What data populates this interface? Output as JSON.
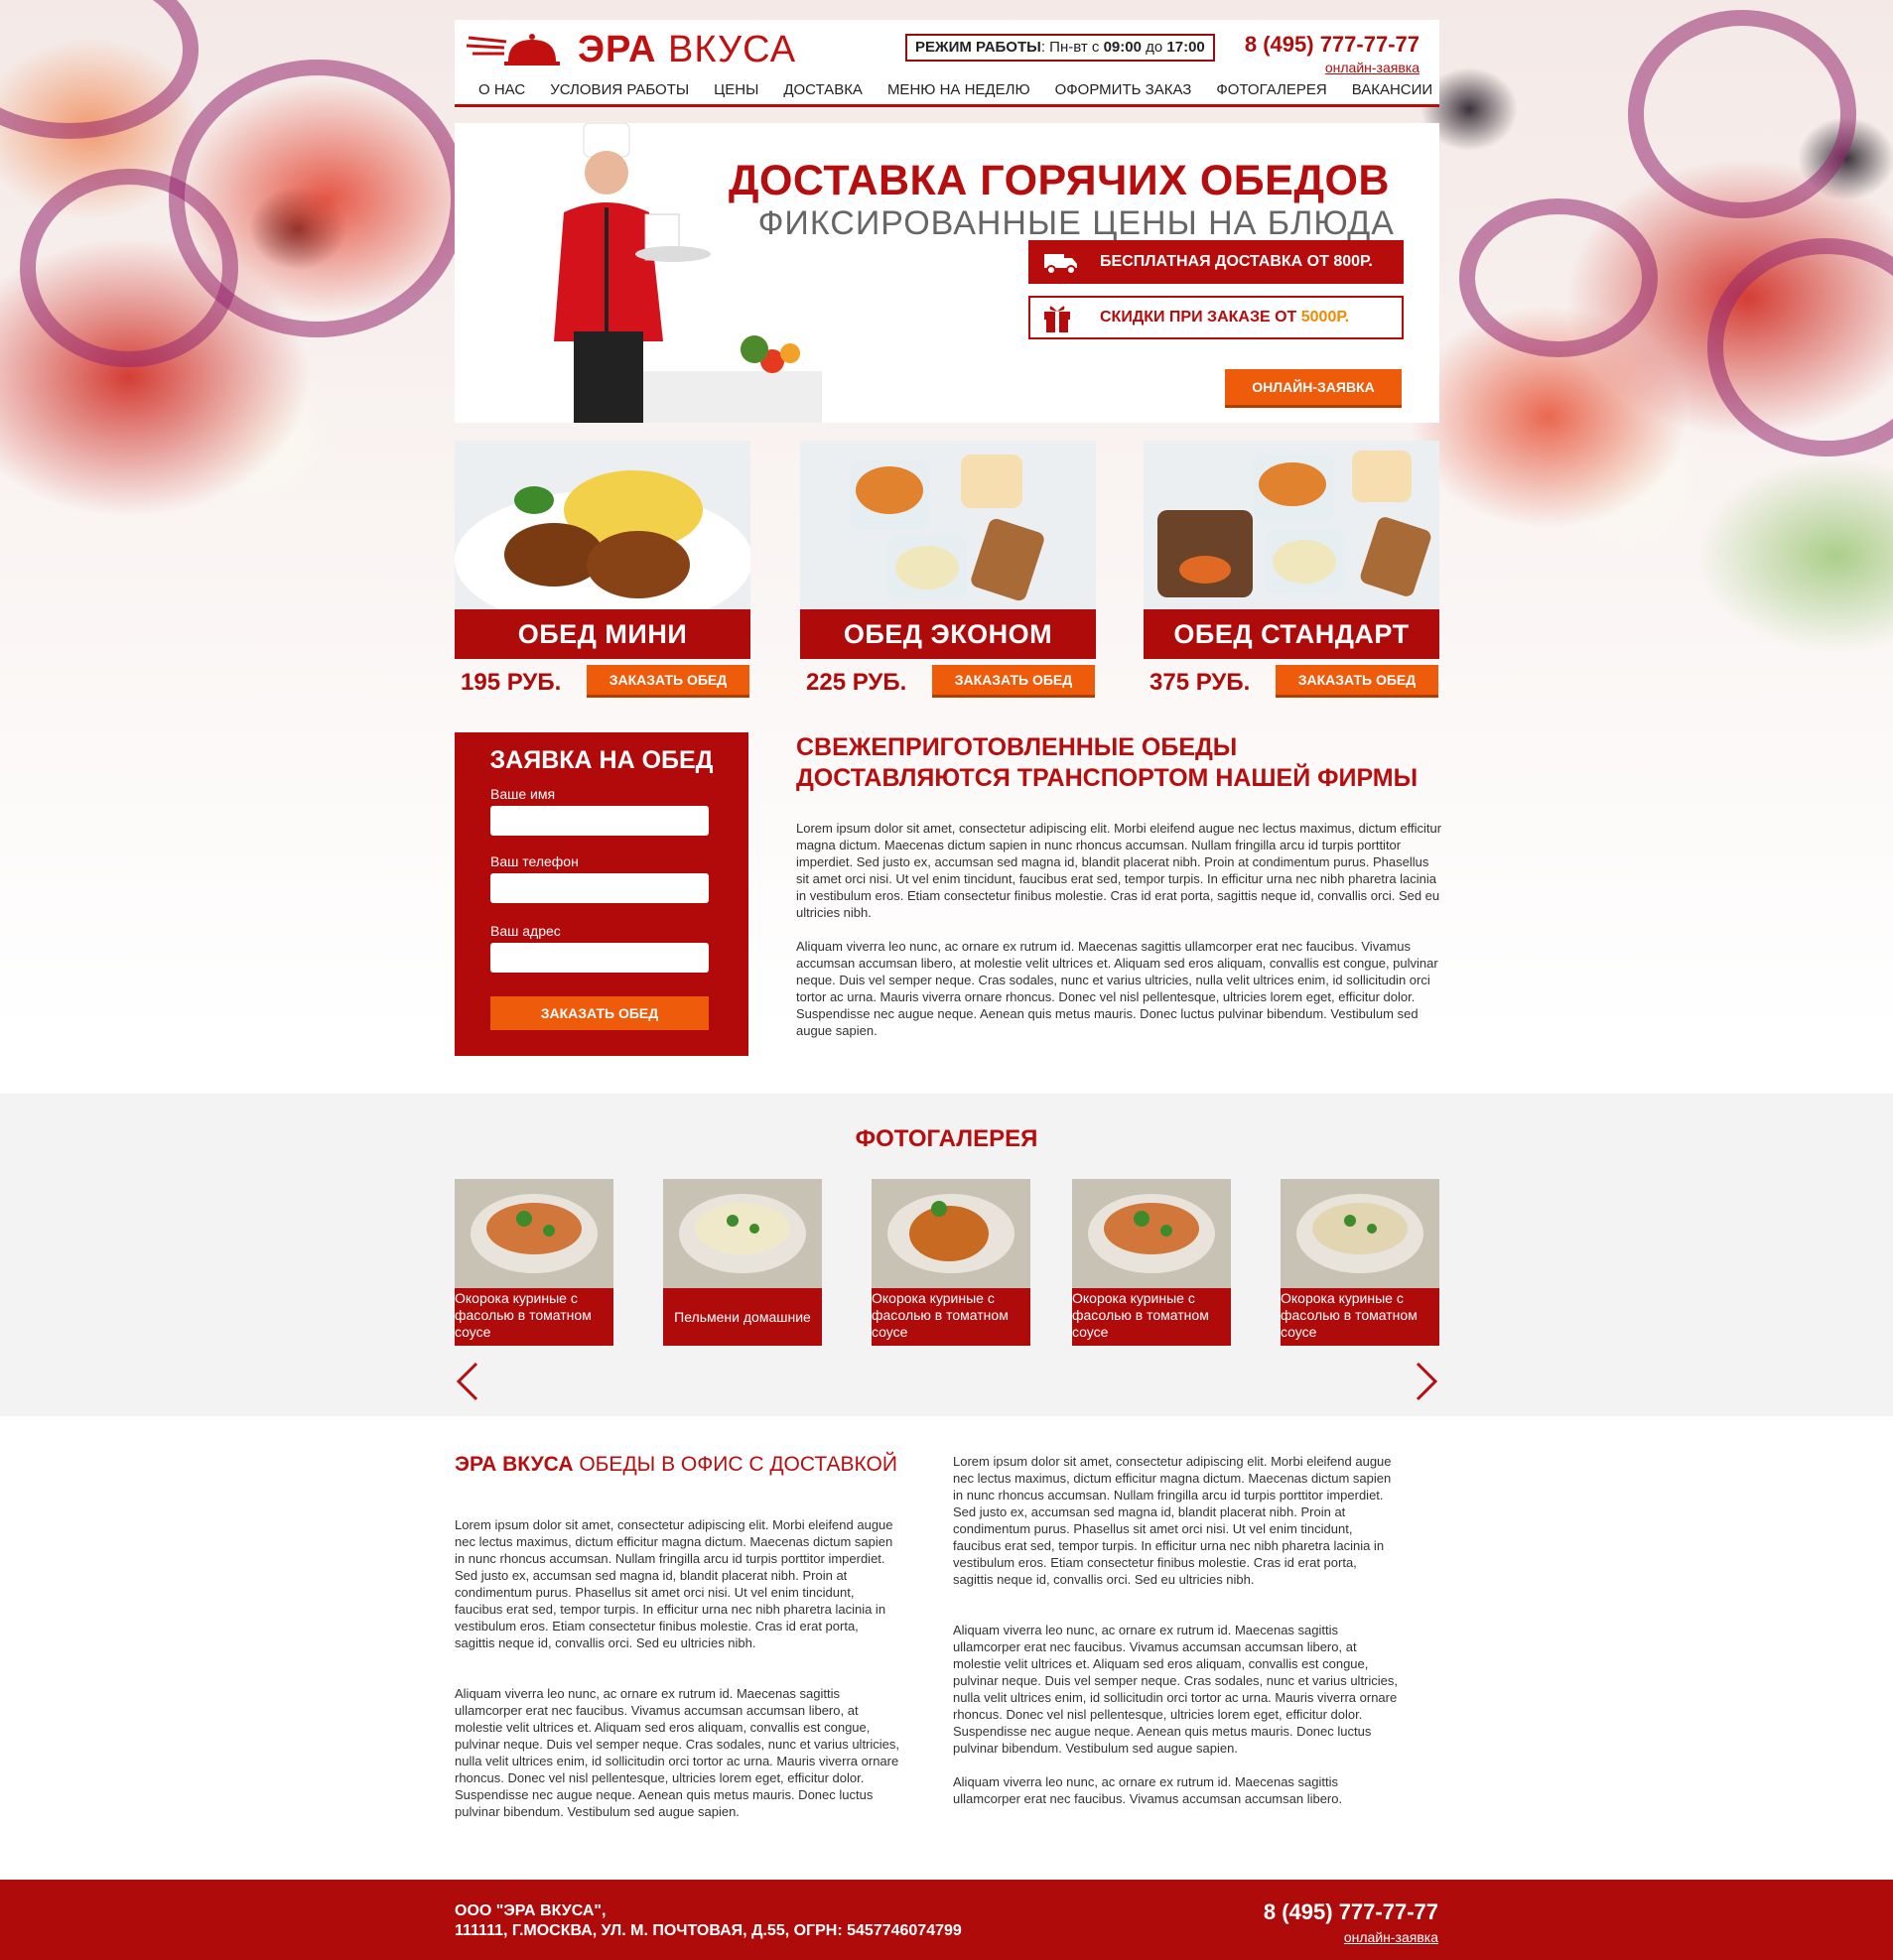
{
  "brand": {
    "name_bold": "ЭРА",
    "name_light": "ВКУСА",
    "accent": "#b60c0c",
    "orange": "#ee5b0b"
  },
  "header": {
    "hours_label": "РЕЖИМ РАБОТЫ",
    "hours_days": ": Пн-вт с ",
    "hours_from": "09:00",
    "hours_to_word": " до ",
    "hours_to": "17:00",
    "phone": "8 (495) 777-77-77",
    "online_link": "онлайн-заявка"
  },
  "nav": [
    "О НАС",
    "УСЛОВИЯ РАБОТЫ",
    "ЦЕНЫ",
    "ДОСТАВКА",
    "МЕНЮ НА НЕДЕЛЮ",
    "ОФОРМИТЬ ЗАКАЗ",
    "ФОТОГАЛЕРЕЯ",
    "ВАКАНСИИ"
  ],
  "hero": {
    "title": "ДОСТАВКА ГОРЯЧИХ ОБЕДОВ",
    "subtitle": "ФИКСИРОВАННЫЕ ЦЕНЫ НА БЛЮДА",
    "badge_free": "БЕСПЛАТНАЯ ДОСТАВКА ОТ 800Р.",
    "badge_discount": "СКИДКИ ПРИ ЗАКАЗЕ ОТ ",
    "badge_discount_value": "5000Р.",
    "button": "ОНЛАЙН-ЗАЯВКА",
    "icons": {
      "delivery": "delivery-truck-icon",
      "gift": "gift-icon"
    }
  },
  "lunches": [
    {
      "name": "ОБЕД МИНИ",
      "price": "195 РУБ.",
      "button": "ЗАКАЗАТЬ ОБЕД"
    },
    {
      "name": "ОБЕД ЭКОНОМ",
      "price": "225 РУБ.",
      "button": "ЗАКАЗАТЬ ОБЕД"
    },
    {
      "name": "ОБЕД СТАНДАРТ",
      "price": "375 РУБ.",
      "button": "ЗАКАЗАТЬ ОБЕД"
    }
  ],
  "form": {
    "title": "ЗАЯВКА НА ОБЕД",
    "name_label": "Ваше имя",
    "phone_label": "Ваш телефон",
    "address_label": "Ваш адрес",
    "name_value": "",
    "phone_value": "",
    "address_value": "",
    "submit": "ЗАКАЗАТЬ ОБЕД"
  },
  "fresh": {
    "title": "СВЕЖЕПРИГОТОВЛЕННЫЕ ОБЕДЫ ДОСТАВЛЯЮТСЯ ТРАНСПОРТОМ НАШЕЙ ФИРМЫ",
    "p1": "Lorem ipsum dolor sit amet, consectetur adipiscing elit. Morbi eleifend augue nec lectus maximus, dictum efficitur magna dictum. Maecenas dictum sapien in nunc rhoncus accumsan. Nullam fringilla arcu id turpis porttitor imperdiet. Sed justo ex, accumsan sed magna id, blandit placerat nibh. Proin at condimentum purus. Phasellus sit amet orci nisi. Ut vel enim tincidunt, faucibus erat sed, tempor turpis. In efficitur urna nec nibh pharetra lacinia in vestibulum eros. Etiam consectetur finibus molestie. Cras id erat porta, sagittis neque id, convallis orci. Sed eu ultricies nibh.",
    "p2": "Aliquam viverra leo nunc, ac ornare ex rutrum id. Maecenas sagittis ullamcorper erat nec faucibus. Vivamus accumsan accumsan libero, at molestie velit ultrices et. Aliquam sed eros aliquam, convallis est congue, pulvinar neque. Duis vel semper neque. Cras sodales, nunc et varius ultricies, nulla velit ultrices enim, id sollicitudin orci tortor ac urna. Mauris viverra ornare rhoncus. Donec vel nisl pellentesque, ultricies lorem eget, efficitur dolor. Suspendisse nec augue neque. Aenean quis metus mauris. Donec luctus pulvinar bibendum. Vestibulum sed augue sapien."
  },
  "gallery": {
    "title": "ФОТОГАЛЕРЕЯ",
    "items": [
      "Окорока куриные  с фасолью в томатном соусе",
      "Пельмени домашние",
      "Окорока куриные  с фасолью в томатном соусе",
      "Окорока куриные  с фасолью в томатном соусе",
      "Окорока куриные  с фасолью в томатном соусе"
    ],
    "icons": {
      "prev": "chevron-left-icon",
      "next": "chevron-right-icon"
    }
  },
  "about": {
    "title_bold": "ЭРА ВКУСА",
    "title_rest": " ОБЕДЫ В ОФИС С ДОСТАВКОЙ",
    "left_p1": "Lorem ipsum dolor sit amet, consectetur adipiscing elit. Morbi eleifend augue nec lectus maximus, dictum efficitur magna dictum. Maecenas dictum sapien in nunc rhoncus accumsan. Nullam fringilla arcu id turpis porttitor imperdiet. Sed justo ex, accumsan sed magna id, blandit placerat nibh. Proin at condimentum purus. Phasellus sit amet orci nisi. Ut vel enim tincidunt, faucibus erat sed, tempor turpis. In efficitur urna nec nibh pharetra lacinia in vestibulum eros. Etiam consectetur finibus molestie. Cras id erat porta, sagittis neque id, convallis orci. Sed eu ultricies nibh.",
    "left_p2": "Aliquam viverra leo nunc, ac ornare ex rutrum id. Maecenas sagittis ullamcorper erat nec faucibus. Vivamus accumsan accumsan libero, at molestie velit ultrices et. Aliquam sed eros aliquam, convallis est congue, pulvinar neque. Duis vel semper neque. Cras sodales, nunc et varius ultricies, nulla velit ultrices enim, id sollicitudin orci tortor ac urna. Mauris viverra ornare rhoncus. Donec vel nisl pellentesque, ultricies lorem eget, efficitur dolor. Suspendisse nec augue neque. Aenean quis metus mauris. Donec luctus pulvinar bibendum. Vestibulum sed augue sapien.",
    "right_p1": "Lorem ipsum dolor sit amet, consectetur adipiscing elit. Morbi eleifend augue nec lectus maximus, dictum efficitur magna dictum. Maecenas dictum sapien in nunc rhoncus accumsan. Nullam fringilla arcu id turpis porttitor imperdiet. Sed justo ex, accumsan sed magna id, blandit placerat nibh. Proin at condimentum purus. Phasellus sit amet orci nisi. Ut vel enim tincidunt, faucibus erat sed, tempor turpis. In efficitur urna nec nibh pharetra lacinia in vestibulum eros. Etiam consectetur finibus molestie. Cras id erat porta, sagittis neque id, convallis orci. Sed eu ultricies nibh.",
    "right_p2": "Aliquam viverra leo nunc, ac ornare ex rutrum id. Maecenas sagittis ullamcorper erat nec faucibus. Vivamus accumsan accumsan libero, at molestie velit ultrices et. Aliquam sed eros aliquam, convallis est congue, pulvinar neque. Duis vel semper neque. Cras sodales, nunc et varius ultricies, nulla velit ultrices enim, id sollicitudin orci tortor ac urna. Mauris viverra ornare rhoncus. Donec vel nisl pellentesque, ultricies lorem eget, efficitur dolor. Suspendisse nec augue neque. Aenean quis metus mauris. Donec luctus pulvinar bibendum. Vestibulum sed augue sapien.",
    "right_p3": "Aliquam viverra leo nunc, ac ornare ex rutrum id. Maecenas sagittis ullamcorper erat nec faucibus. Vivamus accumsan accumsan libero."
  },
  "footer": {
    "company": "ООО \"ЭРА ВКУСА\",",
    "address": "111111, Г.МОСКВА, УЛ. М. ПОЧТОВАЯ, Д.55, ОГРН: 5457746074799",
    "phone": "8 (495) 777-77-77",
    "online_link": "онлайн-заявка"
  }
}
